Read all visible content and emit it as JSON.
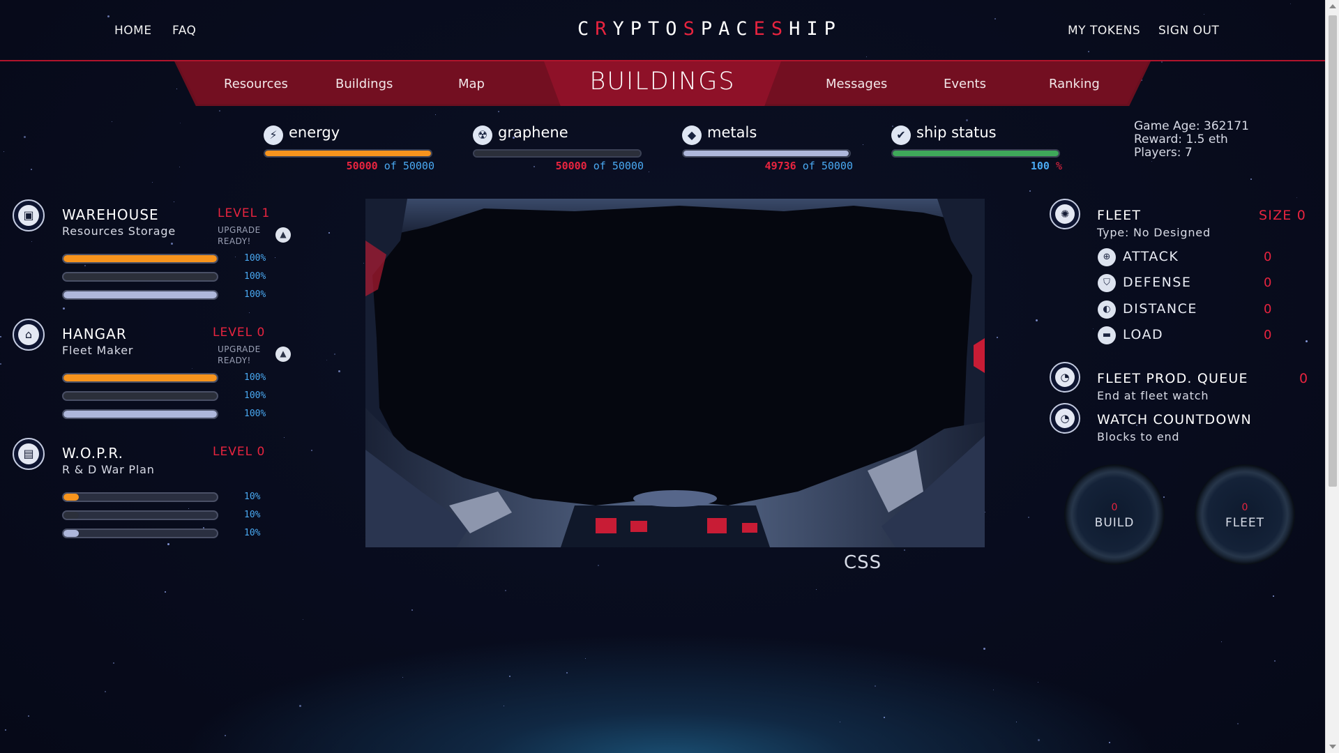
{
  "header": {
    "nav_left": [
      "HOME",
      "FAQ"
    ],
    "logo_parts": [
      {
        "t": "C",
        "r": false
      },
      {
        "t": "R",
        "r": true
      },
      {
        "t": "YPTO",
        "r": false
      },
      {
        "t": "S",
        "r": true
      },
      {
        "t": "PAC",
        "r": false
      },
      {
        "t": "E",
        "r": true
      },
      {
        "t": "S",
        "r": true
      },
      {
        "t": "HIP",
        "r": false
      }
    ],
    "nav_right": [
      "MY TOKENS",
      "SIGN OUT"
    ]
  },
  "tabs": {
    "left": [
      "Resources",
      "Buildings",
      "Map"
    ],
    "active": "BUILDINGS",
    "right": [
      "Messages",
      "Events",
      "Ranking"
    ]
  },
  "resources": [
    {
      "name": "energy",
      "icon": "lightning-icon",
      "current": "50000",
      "sep": "of",
      "max": "50000",
      "fill": 1.0,
      "color": "#f7941d"
    },
    {
      "name": "graphene",
      "icon": "radiation-icon",
      "current": "50000",
      "sep": "of",
      "max": "50000",
      "fill": 1.0,
      "color": "#2b2f3a"
    },
    {
      "name": "metals",
      "icon": "ore-icon",
      "current": "49736",
      "sep": "of",
      "max": "50000",
      "fill": 0.995,
      "color": "#aeb7db"
    },
    {
      "name": "ship status",
      "icon": "check-icon",
      "current": "100",
      "sep": "",
      "max": "%",
      "fill": 1.0,
      "color": "#3fa85a"
    }
  ],
  "game_info": {
    "age": "Game Age: 362171",
    "reward": "Reward: 1.5 eth",
    "players": "Players: 7"
  },
  "buildings": [
    {
      "name": "WAREHOUSE",
      "subtitle": "Resources Storage",
      "level": "LEVEL 1",
      "upgrade": [
        "UPGRADE",
        "READY!"
      ],
      "icon": "box-icon",
      "bars": [
        {
          "fill": 1.0,
          "pct": "100%",
          "color": "#f7941d"
        },
        {
          "fill": 1.0,
          "pct": "100%",
          "color": "#2b2f3a"
        },
        {
          "fill": 1.0,
          "pct": "100%",
          "color": "#aeb7db"
        }
      ]
    },
    {
      "name": "HANGAR",
      "subtitle": "Fleet Maker",
      "level": "LEVEL 0",
      "upgrade": [
        "UPGRADE",
        "READY!"
      ],
      "icon": "hangar-icon",
      "bars": [
        {
          "fill": 1.0,
          "pct": "100%",
          "color": "#f7941d"
        },
        {
          "fill": 1.0,
          "pct": "100%",
          "color": "#2b2f3a"
        },
        {
          "fill": 1.0,
          "pct": "100%",
          "color": "#aeb7db"
        }
      ]
    },
    {
      "name": "W.O.P.R.",
      "subtitle": "R & D War Plan",
      "level": "LEVEL 0",
      "upgrade": [],
      "icon": "computer-icon",
      "bars": [
        {
          "fill": 0.1,
          "pct": "10%",
          "color": "#f7941d"
        },
        {
          "fill": 0.1,
          "pct": "10%",
          "color": "#2b2f3a"
        },
        {
          "fill": 0.1,
          "pct": "10%",
          "color": "#aeb7db"
        }
      ]
    }
  ],
  "viewport_label": "CSS",
  "fleet": {
    "title": "FLEET",
    "size": "SIZE 0",
    "type": "Type: No Designed",
    "stats": [
      {
        "label": "ATTACK",
        "value": "0",
        "icon": "crosshair-icon"
      },
      {
        "label": "DEFENSE",
        "value": "0",
        "icon": "shield-icon"
      },
      {
        "label": "DISTANCE",
        "value": "0",
        "icon": "planet-icon"
      },
      {
        "label": "LOAD",
        "value": "0",
        "icon": "cargo-icon"
      }
    ],
    "queue_title": "FLEET PROD. QUEUE",
    "queue_value": "0",
    "queue_sub": "End at fleet watch",
    "watch_title": "WATCH COUNTDOWN",
    "watch_sub": "Blocks to end"
  },
  "dials": [
    {
      "value": "0",
      "label": "BUILD"
    },
    {
      "value": "0",
      "label": "FLEET"
    }
  ]
}
